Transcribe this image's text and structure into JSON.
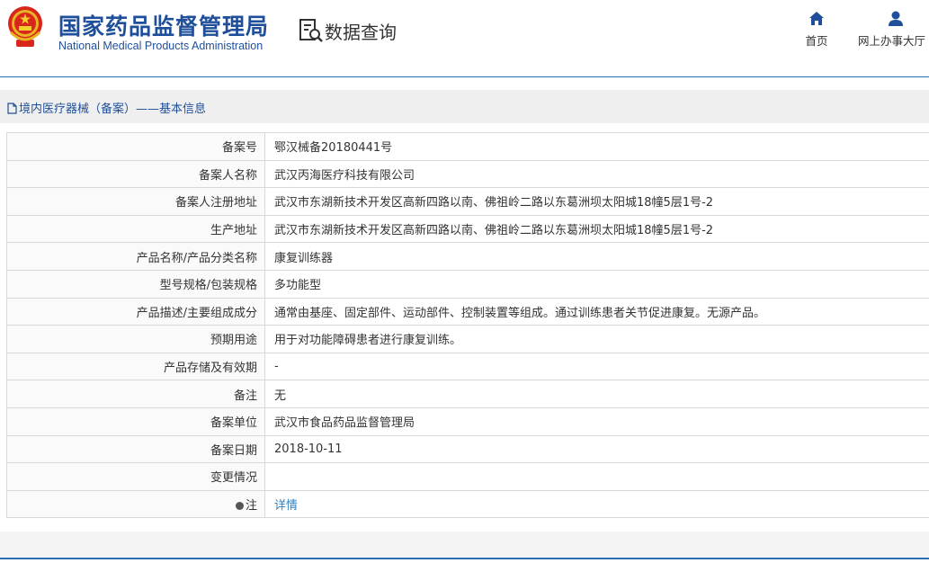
{
  "header": {
    "logo_cn": "国家药品监督管理局",
    "logo_en": "National Medical Products Administration",
    "query_label": "数据查询",
    "nav": [
      {
        "label": "首页",
        "icon": "home-icon"
      },
      {
        "label": "网上办事大厅",
        "icon": "user-icon"
      }
    ]
  },
  "section": {
    "title": "境内医疗器械（备案）——基本信息",
    "icon": "document-icon"
  },
  "rows": [
    {
      "label": "备案号",
      "value": "鄂汉械备20180441号"
    },
    {
      "label": "备案人名称",
      "value": "武汉丙海医疗科技有限公司"
    },
    {
      "label": "备案人注册地址",
      "value": "武汉市东湖新技术开发区高新四路以南、佛祖岭二路以东葛洲坝太阳城18幢5层1号-2"
    },
    {
      "label": "生产地址",
      "value": "武汉市东湖新技术开发区高新四路以南、佛祖岭二路以东葛洲坝太阳城18幢5层1号-2"
    },
    {
      "label": "产品名称/产品分类名称",
      "value": "康复训练器"
    },
    {
      "label": "型号规格/包装规格",
      "value": "多功能型"
    },
    {
      "label": "产品描述/主要组成成分",
      "value": "通常由基座、固定部件、运动部件、控制装置等组成。通过训练患者关节促进康复。无源产品。"
    },
    {
      "label": "预期用途",
      "value": "用于对功能障碍患者进行康复训练。"
    },
    {
      "label": "产品存储及有效期",
      "value": "-"
    },
    {
      "label": "备注",
      "value": "无"
    },
    {
      "label": "备案单位",
      "value": "武汉市食品药品监督管理局"
    },
    {
      "label": "备案日期",
      "value": "2018-10-11"
    },
    {
      "label": "变更情况",
      "value": ""
    }
  ],
  "note_row": {
    "label": "注",
    "icon": "bulb-icon",
    "link_text": "详情"
  },
  "colors": {
    "brand_blue": "#1f4f9a",
    "link_blue": "#2f7fc1",
    "band_gray": "#efefef"
  }
}
